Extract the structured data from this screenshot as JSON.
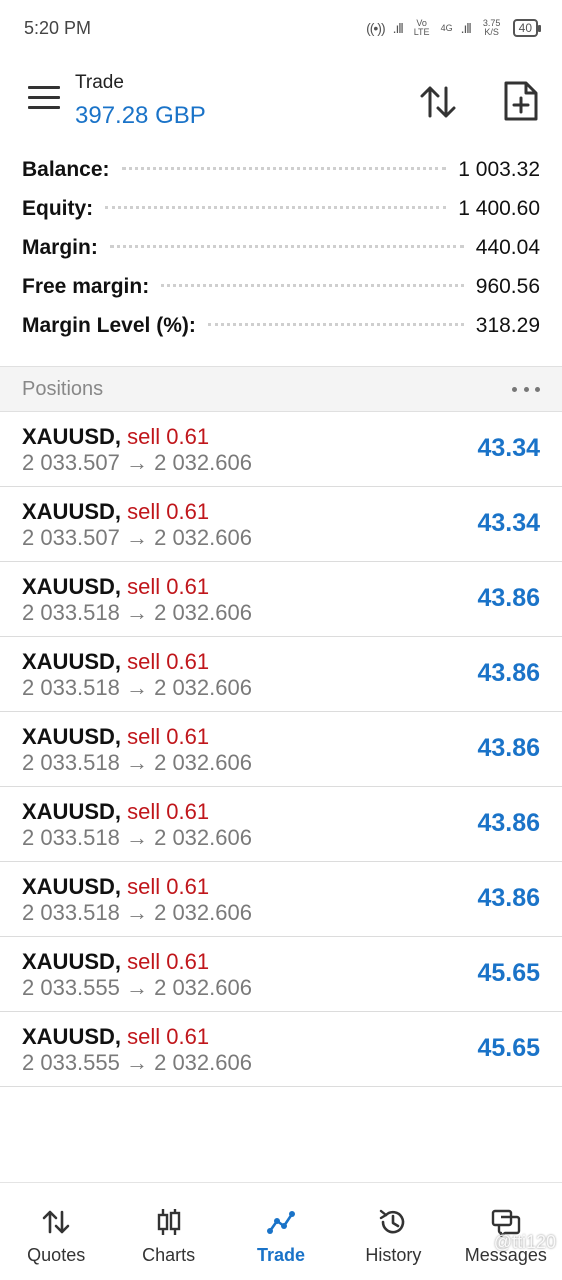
{
  "status_bar": {
    "time": "5:20 PM",
    "vo_lte": "Vo LTE",
    "network": "4G",
    "speed": "3.75 K/S",
    "battery": "40"
  },
  "header": {
    "title": "Trade",
    "balance_display": "397.28 GBP"
  },
  "summary": [
    {
      "label": "Balance:",
      "value": "1 003.32"
    },
    {
      "label": "Equity:",
      "value": "1 400.60"
    },
    {
      "label": "Margin:",
      "value": "440.04"
    },
    {
      "label": "Free margin:",
      "value": "960.56"
    },
    {
      "label": "Margin Level (%):",
      "value": "318.29"
    }
  ],
  "positions_header": "Positions",
  "positions": [
    {
      "symbol": "XAUUSD,",
      "side": "sell 0.61",
      "prices": "2 033.507 → 2 032.606",
      "profit": "43.34"
    },
    {
      "symbol": "XAUUSD,",
      "side": "sell 0.61",
      "prices": "2 033.507 → 2 032.606",
      "profit": "43.34"
    },
    {
      "symbol": "XAUUSD,",
      "side": "sell 0.61",
      "prices": "2 033.518 → 2 032.606",
      "profit": "43.86"
    },
    {
      "symbol": "XAUUSD,",
      "side": "sell 0.61",
      "prices": "2 033.518 → 2 032.606",
      "profit": "43.86"
    },
    {
      "symbol": "XAUUSD,",
      "side": "sell 0.61",
      "prices": "2 033.518 → 2 032.606",
      "profit": "43.86"
    },
    {
      "symbol": "XAUUSD,",
      "side": "sell 0.61",
      "prices": "2 033.518 → 2 032.606",
      "profit": "43.86"
    },
    {
      "symbol": "XAUUSD,",
      "side": "sell 0.61",
      "prices": "2 033.518 → 2 032.606",
      "profit": "43.86"
    },
    {
      "symbol": "XAUUSD,",
      "side": "sell 0.61",
      "prices": "2 033.555 → 2 032.606",
      "profit": "45.65"
    },
    {
      "symbol": "XAUUSD,",
      "side": "sell 0.61",
      "prices": "2 033.555 → 2 032.606",
      "profit": "45.65"
    }
  ],
  "bottom_nav": [
    {
      "label": "Quotes",
      "icon": "quotes-icon"
    },
    {
      "label": "Charts",
      "icon": "charts-icon"
    },
    {
      "label": "Trade",
      "icon": "trade-icon"
    },
    {
      "label": "History",
      "icon": "history-icon"
    },
    {
      "label": "Messages",
      "icon": "messages-icon"
    }
  ],
  "watermark": "@tti120",
  "colors": {
    "accent": "#1a73c8",
    "sell": "#c0161b",
    "muted": "#7a7a7a"
  }
}
